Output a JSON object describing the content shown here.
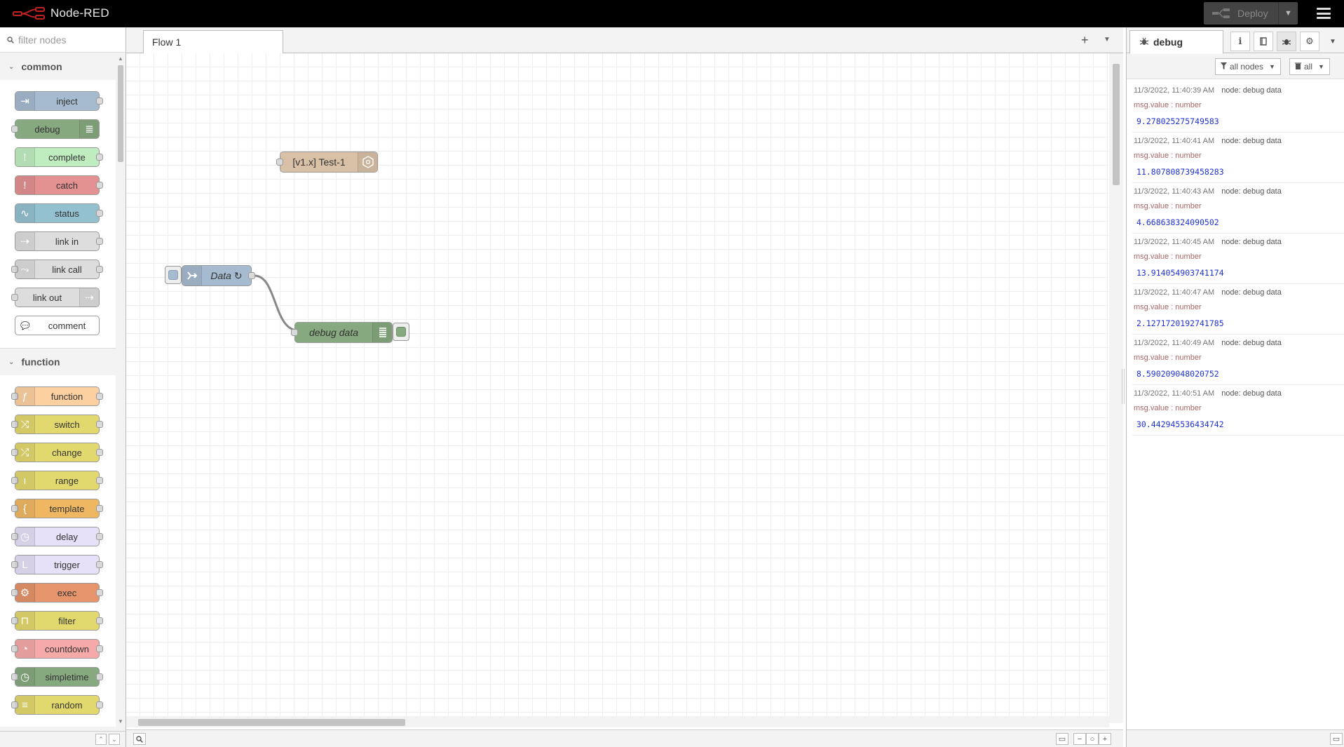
{
  "header": {
    "title": "Node-RED",
    "deploy_label": "Deploy"
  },
  "palette": {
    "search_placeholder": "filter nodes",
    "categories": [
      {
        "name": "common",
        "nodes": [
          {
            "label": "inject",
            "color": "#a6bbcf",
            "icon": "arrow-right-icon"
          },
          {
            "label": "debug",
            "color": "#87a980",
            "icon": "list-icon"
          },
          {
            "label": "complete",
            "color": "#c0edc0",
            "icon": "exclamation-icon"
          },
          {
            "label": "catch",
            "color": "#e49191",
            "icon": "exclamation-icon"
          },
          {
            "label": "status",
            "color": "#94c1d0",
            "icon": "pulse-icon"
          },
          {
            "label": "link in",
            "color": "#dddddd",
            "icon": "link-in-icon"
          },
          {
            "label": "link call",
            "color": "#dddddd",
            "icon": "link-call-icon"
          },
          {
            "label": "link out",
            "color": "#dddddd",
            "icon": "link-out-icon"
          },
          {
            "label": "comment",
            "color": "#ffffff",
            "icon": "comment-icon"
          }
        ]
      },
      {
        "name": "function",
        "nodes": [
          {
            "label": "function",
            "color": "#fdd0a2",
            "icon": "function-icon"
          },
          {
            "label": "switch",
            "color": "#e2d96e",
            "icon": "switch-icon"
          },
          {
            "label": "change",
            "color": "#e2d96e",
            "icon": "shuffle-icon"
          },
          {
            "label": "range",
            "color": "#e2d96e",
            "icon": "range-icon"
          },
          {
            "label": "template",
            "color": "#f0b762",
            "icon": "brace-icon"
          },
          {
            "label": "delay",
            "color": "#e6e0f8",
            "icon": "clock-icon"
          },
          {
            "label": "trigger",
            "color": "#e6e0f8",
            "icon": "trigger-icon"
          },
          {
            "label": "exec",
            "color": "#e5946b",
            "icon": "cog-icon"
          },
          {
            "label": "filter",
            "color": "#e2d96e",
            "icon": "filter-icon"
          },
          {
            "label": "countdown",
            "color": "#f6a9a9",
            "icon": "timer-icon"
          },
          {
            "label": "simpletime",
            "color": "#87a980",
            "icon": "clock-icon"
          },
          {
            "label": "random",
            "color": "#e2d96e",
            "icon": "random-icon"
          }
        ]
      }
    ]
  },
  "workspace": {
    "tab_label": "Flow 1",
    "nodes": {
      "test": {
        "label": "[v1.x] Test-1",
        "color": "#d9c1a7"
      },
      "inject": {
        "label": "Data ↻",
        "color": "#a6bbcf"
      },
      "debug": {
        "label": "debug data",
        "color": "#87a980"
      }
    }
  },
  "sidebar": {
    "tab_label": "debug",
    "filter_label": "all nodes",
    "clear_label": "all",
    "messages": [
      {
        "time": "11/3/2022, 11:40:39 AM",
        "node": "node: debug data",
        "name": "msg.value : number",
        "value": "9.278025275749583"
      },
      {
        "time": "11/3/2022, 11:40:41 AM",
        "node": "node: debug data",
        "name": "msg.value : number",
        "value": "11.807808739458283"
      },
      {
        "time": "11/3/2022, 11:40:43 AM",
        "node": "node: debug data",
        "name": "msg.value : number",
        "value": "4.668638324090502"
      },
      {
        "time": "11/3/2022, 11:40:45 AM",
        "node": "node: debug data",
        "name": "msg.value : number",
        "value": "13.914054903741174"
      },
      {
        "time": "11/3/2022, 11:40:47 AM",
        "node": "node: debug data",
        "name": "msg.value : number",
        "value": "2.1271720192741785"
      },
      {
        "time": "11/3/2022, 11:40:49 AM",
        "node": "node: debug data",
        "name": "msg.value : number",
        "value": "8.590209048020752"
      },
      {
        "time": "11/3/2022, 11:40:51 AM",
        "node": "node: debug data",
        "name": "msg.value : number",
        "value": "30.442945536434742"
      }
    ]
  }
}
